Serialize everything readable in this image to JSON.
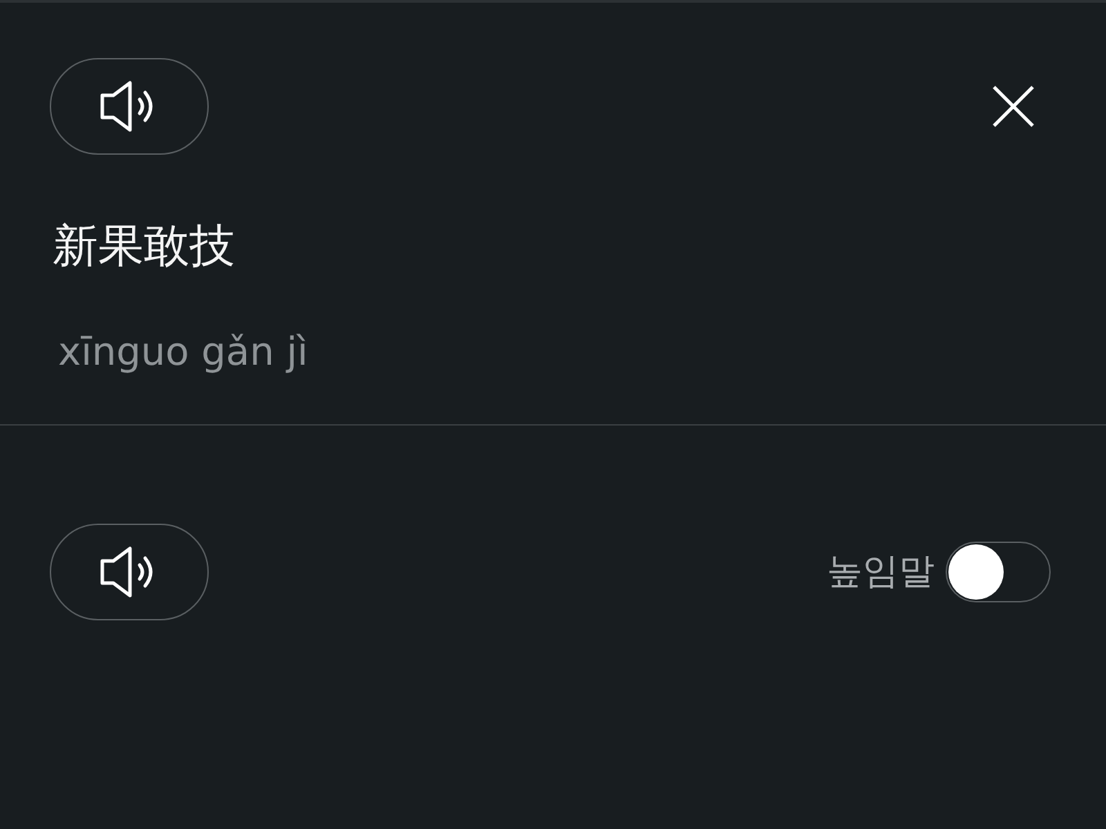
{
  "source": {
    "text": "新果敢技",
    "pinyin": "xīnguo gǎn jì"
  },
  "honorific": {
    "label": "높임말",
    "on": false
  }
}
